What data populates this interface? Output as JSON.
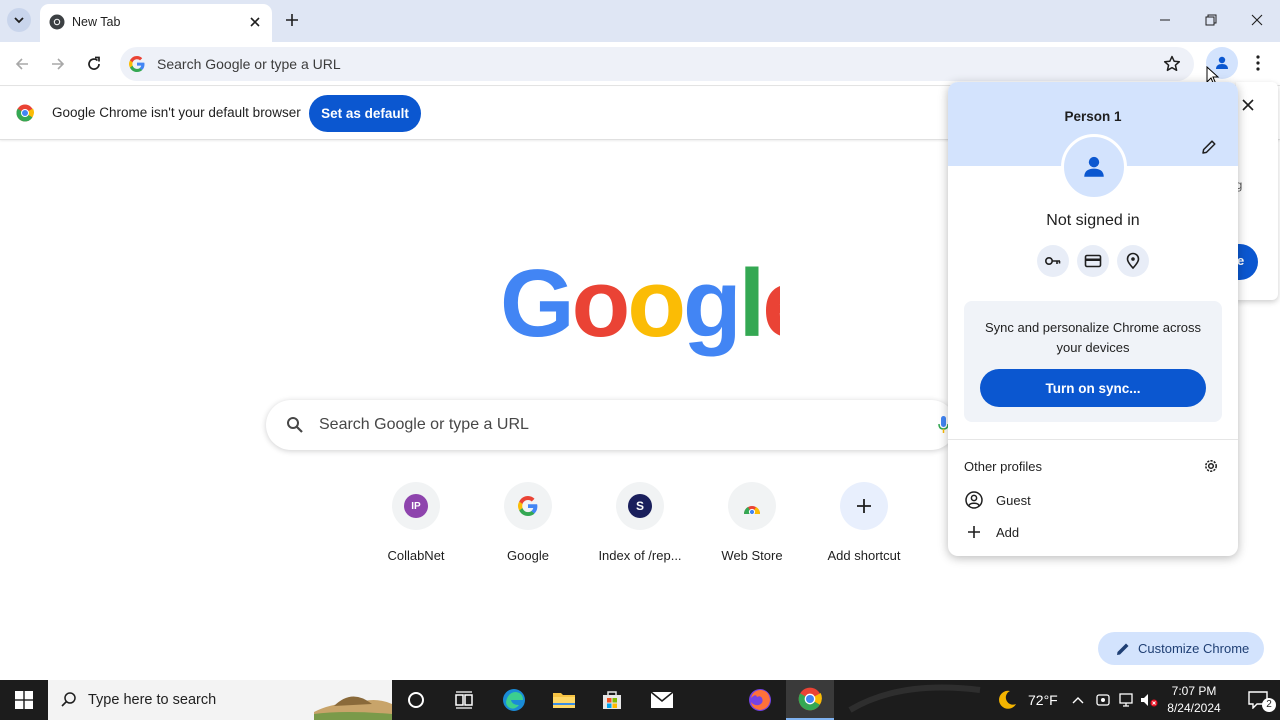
{
  "browser": {
    "tab": {
      "title": "New Tab"
    },
    "omnibox": {
      "placeholder": "Search Google or type a URL"
    }
  },
  "infobar": {
    "message": "Google Chrome isn't your default browser",
    "set_default_label": "Set as default"
  },
  "ntp": {
    "search_placeholder": "Search Google or type a URL",
    "shortcuts": [
      {
        "label": "CollabNet",
        "badge": "IP",
        "badge_color": "#8e44ad"
      },
      {
        "label": "Google",
        "badge": "G",
        "badge_color": "#4285f4"
      },
      {
        "label": "Index of /rep...",
        "badge": "S",
        "badge_color": "#1a1f5c"
      },
      {
        "label": "Web Store",
        "badge": "",
        "badge_color": "#34a853"
      },
      {
        "label": "Add shortcut",
        "badge": "+",
        "badge_color": "#1f1f1f"
      }
    ],
    "customize_label": "Customize Chrome"
  },
  "profile_menu": {
    "name": "Person 1",
    "status": "Not signed in",
    "sync_text": "Sync and personalize Chrome across your devices",
    "sync_button": "Turn on sync...",
    "other_profiles_label": "Other profiles",
    "profiles": [
      {
        "label": "Guest",
        "icon": "guest-icon"
      },
      {
        "label": "Add",
        "icon": "plus-icon"
      }
    ],
    "quick_actions": [
      "passwords-key-icon",
      "payment-card-icon",
      "addresses-pin-icon"
    ]
  },
  "behind_panel": {
    "fragment_text": "ng",
    "button_fragment": "e"
  },
  "taskbar": {
    "search_placeholder": "Type here to search",
    "weather": "72°F",
    "time": "7:07 PM",
    "date": "8/24/2024",
    "notification_count": "2"
  },
  "colors": {
    "accent": "#0b57d0",
    "header_tint": "#d3e3fd",
    "tabstrip": "#dfe6f4"
  }
}
